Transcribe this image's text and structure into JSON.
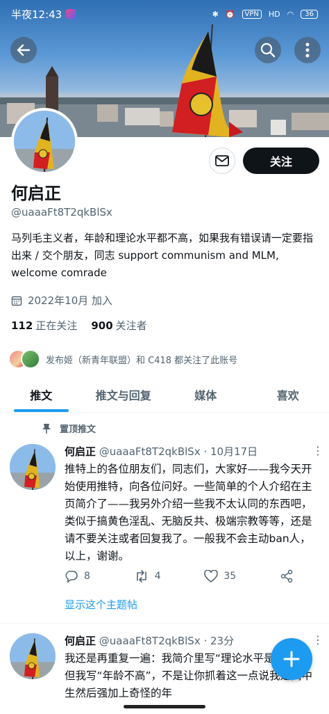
{
  "status": {
    "time": "半夜12:43",
    "vpn": "VPN",
    "net": "HD",
    "battery": "36"
  },
  "profile": {
    "name": "何启正",
    "handle": "@uaaaFt8T2qkBlSx",
    "bio": "马列毛主义者，年龄和理论水平都不高，如果我有错误请一定要指出来 / 交个朋友，同志 support communism and MLM, welcome comrade",
    "joined": "2022年10月 加入",
    "following_count": "112",
    "following_label": "正在关注",
    "followers_count": "900",
    "followers_label": "关注者",
    "follow_button": "关注",
    "followed_by": "发布姬（新青年联盟）和 C418 都关注了此账号"
  },
  "tabs": [
    "推文",
    "推文与回复",
    "媒体",
    "喜欢"
  ],
  "pinned_label": "置顶推文",
  "tweets": [
    {
      "name": "何启正",
      "meta": "@uaaaFt8T2qkBlSx · 10月17日",
      "text": "推特上的各位朋友们，同志们，大家好——我今天开始使用推特，向各位问好。一些简单的个人介绍在主页简介了——我另外介绍一些我不太认同的东西吧，类似于搞黄色淫乱、无脑反共、极端宗教等等，还是请不要关注或者回复我了。一般我不会主动ban人，以上，谢谢。",
      "replies": "8",
      "retweets": "4",
      "likes": "35",
      "show_thread": "显示这个主题帖"
    },
    {
      "name": "何启正",
      "meta": "@uaaaFt8T2qkBlSx · 23分",
      "text": "我还是再重复一遍：我简介里写“理论水平是真不高，但我写“年龄不高”，不是让你抓着这一点说我是高中生然后强加上奇怪的年"
    }
  ],
  "colors": {
    "accent": "#1d9bf0",
    "text": "#0f1419",
    "secondary": "#536471"
  }
}
